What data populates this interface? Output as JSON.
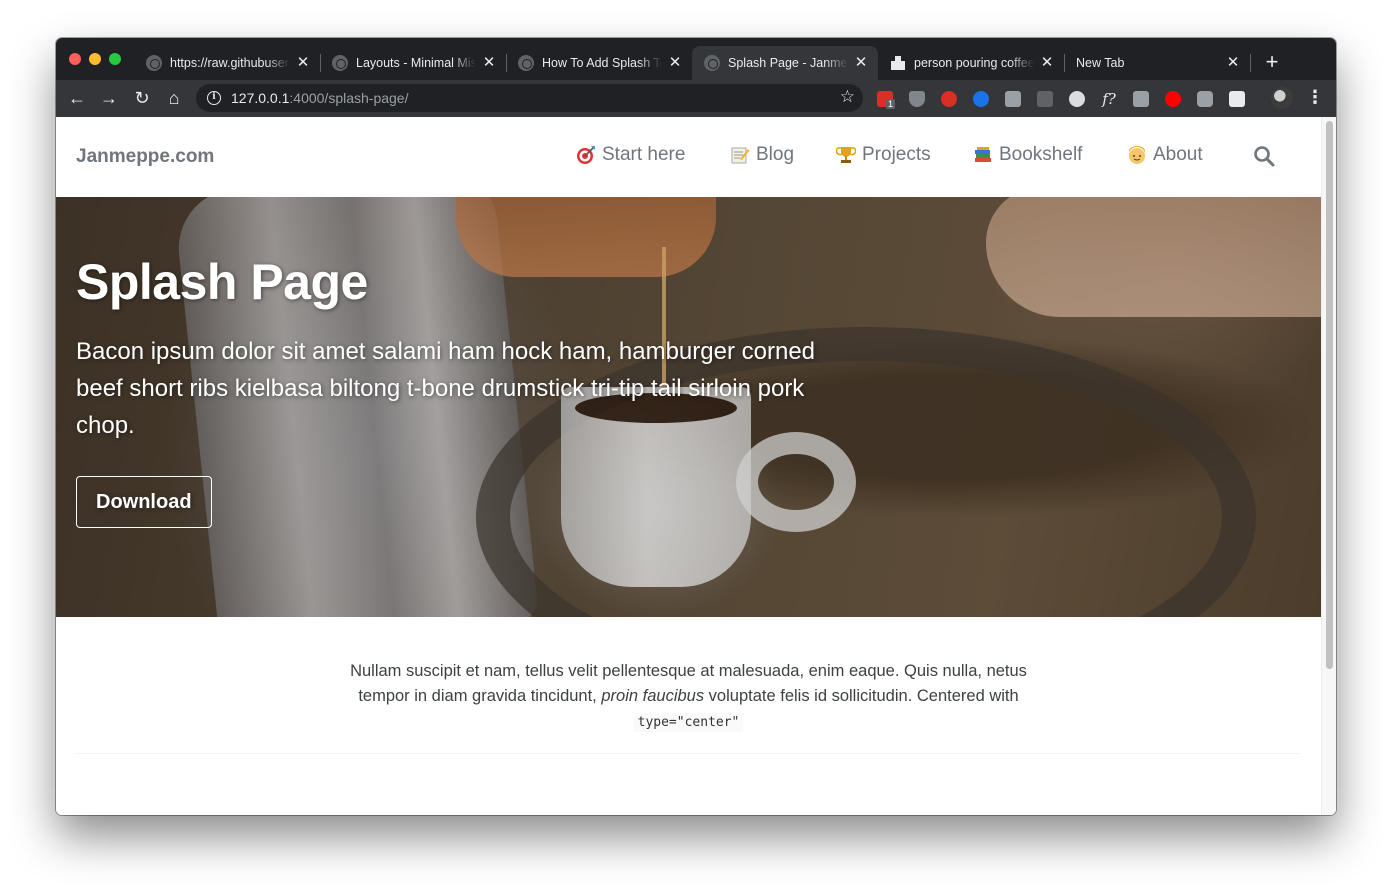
{
  "browser": {
    "tabs": [
      {
        "title": "https://raw.githubusercontent.com",
        "favicon": "globe-icon"
      },
      {
        "title": "Layouts - Minimal Mistakes",
        "favicon": "globe-icon"
      },
      {
        "title": "How To Add Splash Template",
        "favicon": "globe-icon"
      },
      {
        "title": "Splash Page - Janmeppe.com",
        "favicon": "globe-icon",
        "active": true
      },
      {
        "title": "person pouring coffee photo",
        "favicon": "unsplash-icon"
      },
      {
        "title": "New Tab",
        "favicon": ""
      }
    ],
    "url_host": "127.0.0.1",
    "url_rest": ":4000/splash-page/",
    "extension_badge": "1"
  },
  "site": {
    "title": "Janmeppe.com",
    "nav": [
      {
        "label": "Start here",
        "icon": "dart-icon"
      },
      {
        "label": "Blog",
        "icon": "memo-icon"
      },
      {
        "label": "Projects",
        "icon": "trophy-icon"
      },
      {
        "label": "Bookshelf",
        "icon": "books-icon"
      },
      {
        "label": "About",
        "icon": "person-icon"
      }
    ]
  },
  "hero": {
    "title": "Splash Page",
    "excerpt": "Bacon ipsum dolor sit amet salami ham hock ham, hamburger corned beef short ribs kielbasa biltong t-bone drumstick tri-tip tail sirloin pork chop.",
    "button": "Download"
  },
  "content": {
    "text_before": "Nullam suscipit et nam, tellus velit pellentesque at malesuada, enim eaque. Quis nulla, netus tempor in diam gravida tincidunt, ",
    "text_italic": "proin faucibus",
    "text_after": " voluptate felis id sollicitudin. Centered with ",
    "code": "type=\"center\""
  },
  "colors": {
    "chrome_dark": "#202124",
    "chrome_toolbar": "#35363a",
    "nav_text": "#6f777d",
    "body_text": "#3d4144"
  }
}
